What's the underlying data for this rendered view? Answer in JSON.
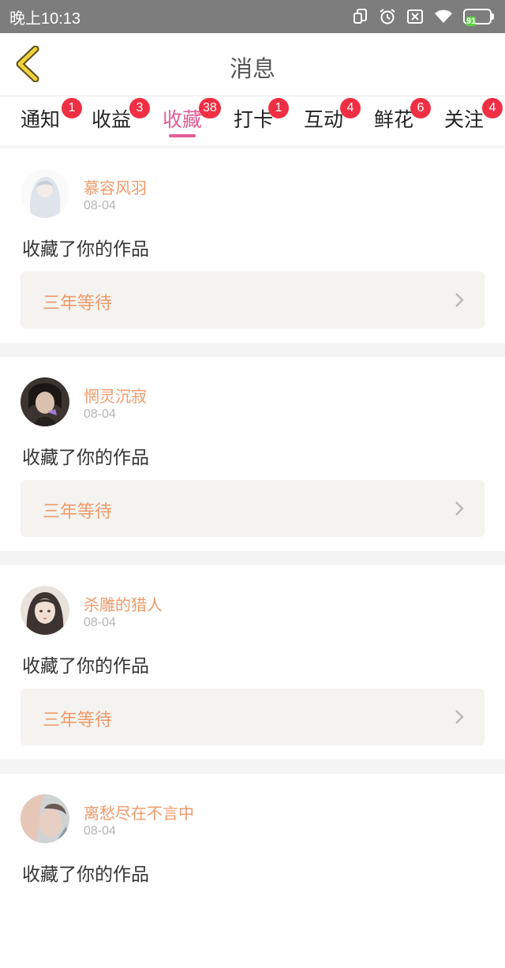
{
  "status": {
    "time": "晚上10:13",
    "battery": "91",
    "icons": [
      "rotate-icon",
      "alarm-icon",
      "sim-off-icon",
      "wifi-icon",
      "battery-icon"
    ]
  },
  "header": {
    "title": "消息",
    "back_icon": "chevron-left-icon"
  },
  "tabs": [
    {
      "label": "通知",
      "badge": "1"
    },
    {
      "label": "收益",
      "badge": "3"
    },
    {
      "label": "收藏",
      "badge": "38",
      "active": true
    },
    {
      "label": "打卡",
      "badge": "1"
    },
    {
      "label": "互动",
      "badge": "4"
    },
    {
      "label": "鲜花",
      "badge": "6"
    },
    {
      "label": "关注",
      "badge": "4"
    }
  ],
  "feed": [
    {
      "user": "慕容风羽",
      "date": "08-04",
      "action": "收藏了你的作品",
      "work": "三年等待"
    },
    {
      "user": "惘灵沉寂",
      "date": "08-04",
      "action": "收藏了你的作品",
      "work": "三年等待"
    },
    {
      "user": "杀雕的猎人",
      "date": "08-04",
      "action": "收藏了你的作品",
      "work": "三年等待"
    },
    {
      "user": "离愁尽在不言中",
      "date": "08-04",
      "action": "收藏了你的作品",
      "work": ""
    }
  ],
  "colors": {
    "accent_pink": "#e25d98",
    "username_orange": "#ef9a6a",
    "badge_red": "#f02f44",
    "back_yellow": "#f2d23b"
  }
}
